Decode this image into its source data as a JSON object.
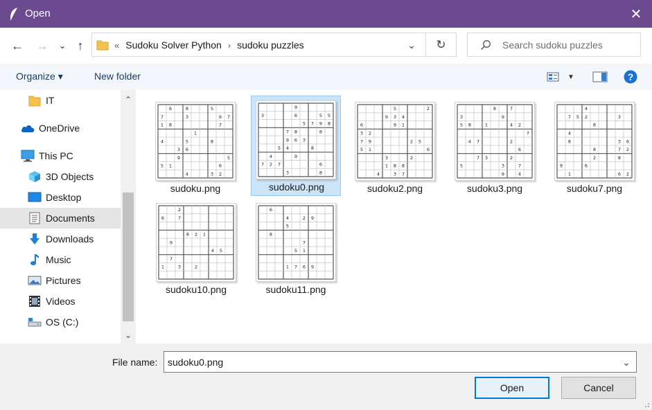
{
  "window": {
    "title": "Open",
    "close_glyph": "✕",
    "titlebar_color": "#6b4a8f",
    "app_icon": "feather-icon"
  },
  "address": {
    "back_glyph": "←",
    "forward_glyph": "→",
    "recent_glyph": "⌄",
    "up_glyph": "↑",
    "overflow_glyph": "«",
    "crumbs": [
      "Sudoku Solver Python",
      "sudoku puzzles"
    ],
    "separator": "›",
    "dropdown_glyph": "⌄",
    "refresh_glyph": "↻"
  },
  "search": {
    "placeholder": "Search sudoku puzzles"
  },
  "toolbar": {
    "organize_label": "Organize ▾",
    "new_folder_label": "New folder",
    "view_dropdown_glyph": "▼",
    "help_glyph": "?"
  },
  "nav": {
    "scroll_up": "⌃",
    "scroll_down": "⌄",
    "items": [
      {
        "label": "IT",
        "icon": "folder-icon"
      },
      {
        "label": "OneDrive",
        "icon": "cloud-icon"
      },
      {
        "label": "This PC",
        "icon": "computer-icon"
      },
      {
        "label": "3D Objects",
        "icon": "cube-icon"
      },
      {
        "label": "Desktop",
        "icon": "desktop-icon"
      },
      {
        "label": "Documents",
        "icon": "document-icon",
        "selected": true
      },
      {
        "label": "Downloads",
        "icon": "download-icon"
      },
      {
        "label": "Music",
        "icon": "music-icon"
      },
      {
        "label": "Pictures",
        "icon": "pictures-icon"
      },
      {
        "label": "Videos",
        "icon": "video-icon"
      },
      {
        "label": "OS (C:)",
        "icon": "drive-icon"
      }
    ]
  },
  "files": [
    {
      "name": "sudoku.png",
      "selected": false,
      "digits": "060800500700300097180000070000010000400500800003600000009000005510000060000400320"
    },
    {
      "name": "sudoku0.png",
      "selected": true,
      "digits": "000090000300060055000005798000780080000963000005400800040090000727000060000300080"
    },
    {
      "name": "sudoku2.png",
      "selected": false,
      "digits": "000050002000934000600091000320000000790000250510000006000300200000188000004037000"
    },
    {
      "name": "sudoku3.png",
      "selected": false,
      "digits": "000080700300009000580100420000000007047000200000000060007300200500003070000009040"
    },
    {
      "name": "sudoku7.png",
      "selected": false,
      "digits": "000400000075200030000080000040000000080000036000080072000020080900600000010000062"
    },
    {
      "name": "sudoku10.png",
      "selected": false,
      "digits": "002000000607000000000000000000821000090000000000000450070000000103020000000000000"
    },
    {
      "name": "sudoku11.png",
      "selected": false,
      "digits": "060000000000402900000500000080000000000007000000051000000000000000176900000000000"
    }
  ],
  "bottom": {
    "file_name_label": "File name:",
    "file_name_value": "sudoku0.png",
    "dropdown_glyph": "⌄",
    "open_label": "Open",
    "cancel_label": "Cancel"
  },
  "colors": {
    "accent": "#0078d7",
    "selection": "#cce4f7",
    "titlebar": "#6b4a8f",
    "help": "#1a6fd1"
  }
}
